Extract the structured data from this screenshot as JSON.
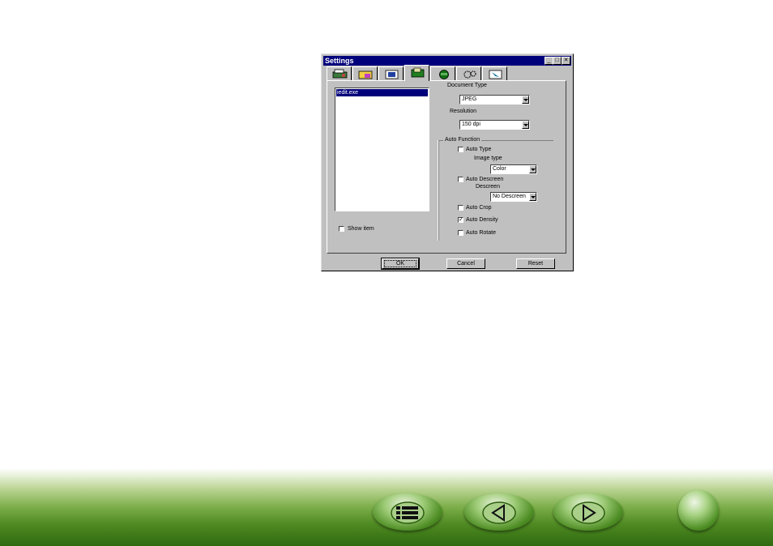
{
  "dialog": {
    "title": "Settings",
    "title_buttons": [
      "_",
      "□",
      "✕"
    ],
    "tabs": [
      {
        "icon": "scan-to-application-icon"
      },
      {
        "icon": "scan-to-folder-icon"
      },
      {
        "icon": "scan-to-email-icon"
      },
      {
        "icon": "scan-to-ocr-icon"
      },
      {
        "icon": "scan-to-printer-icon"
      },
      {
        "icon": "custom-settings-icon"
      },
      {
        "icon": "scan-to-web-icon"
      }
    ],
    "app_list": {
      "items": [
        "iedit.exe"
      ],
      "selected_index": 0
    },
    "show_item": {
      "label": "Show item",
      "checked": false
    },
    "document_type": {
      "label": "Document Type",
      "value": "JPEG"
    },
    "resolution": {
      "label": "Resolution",
      "value": "150 dpi"
    },
    "auto_function": {
      "label": "Auto Function",
      "auto_type": {
        "label": "Auto Type",
        "checked": false
      },
      "image_type": {
        "label": "Image type",
        "value": "Color"
      },
      "auto_descreen": {
        "label": "Auto Descreen",
        "checked": false
      },
      "descreen": {
        "label": "Descreen",
        "value": "No Descreen"
      },
      "auto_crop": {
        "label": "Auto Crop",
        "checked": false
      },
      "auto_density": {
        "label": "Auto Density",
        "checked": true,
        "mark": "✓"
      },
      "auto_rotate": {
        "label": "Auto Rotate",
        "checked": false
      }
    },
    "buttons": {
      "ok": "OK",
      "cancel": "Cancel",
      "reset": "Reset"
    }
  },
  "nav": {
    "buttons": [
      "contents-list-icon",
      "previous-page-icon",
      "next-page-icon",
      "home-dot-icon"
    ],
    "colors": {
      "band_dark": "#2f6a10",
      "band_light": "#b6d28e",
      "button": "#4e8d24"
    }
  },
  "colors": {
    "titlebar": "#00007b",
    "dialog_face": "#c0c0c0",
    "selection": "#00007b"
  }
}
